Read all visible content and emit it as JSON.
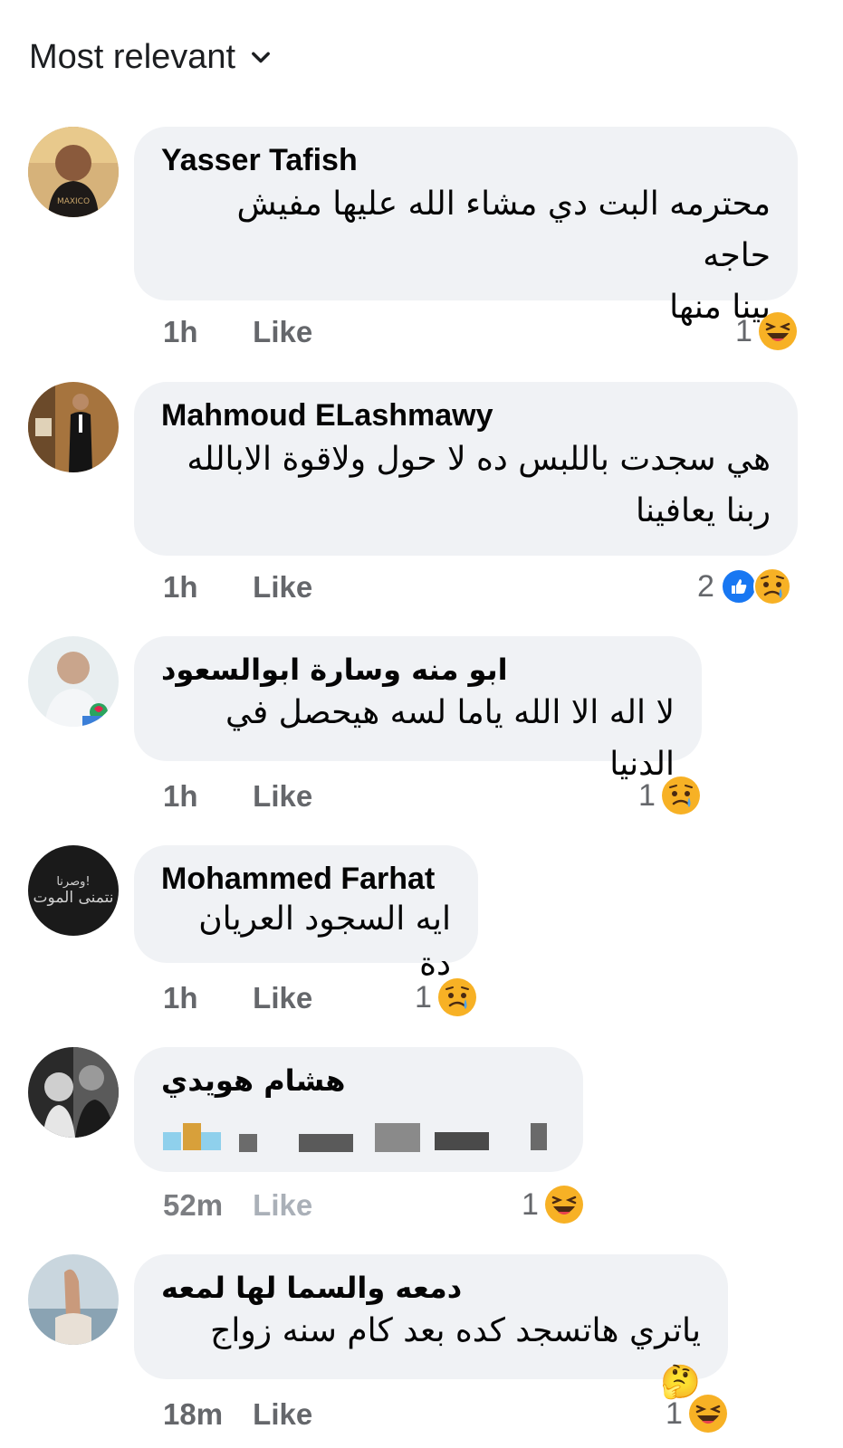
{
  "sort": {
    "label": "Most relevant"
  },
  "comments": [
    {
      "author": "Yasser Tafish",
      "lines": [
        "محترمه البت دي مشاء الله عليها مفيش حاجه",
        "بينا منها"
      ],
      "time": "1h",
      "like": "Like",
      "reaction_count": "1",
      "reactions": [
        "haha"
      ]
    },
    {
      "author": "Mahmoud ELashmawy",
      "lines": [
        "هي سجدت باللبس ده لا حول ولاقوة الابالله",
        "ربنا يعافينا"
      ],
      "time": "1h",
      "like": "Like",
      "reaction_count": "2",
      "reactions": [
        "like",
        "sad"
      ]
    },
    {
      "author": "ابو منه وسارة ابوالسعود",
      "lines": [
        "لا اله الا الله ياما لسه هيحصل في الدنيا"
      ],
      "time": "1h",
      "like": "Like",
      "reaction_count": "1",
      "reactions": [
        "sad"
      ]
    },
    {
      "author": "Mohammed Farhat",
      "lines": [
        "ايه السجود العريان دة"
      ],
      "time": "1h",
      "like": "Like",
      "reaction_count": "1",
      "reactions": [
        "sad"
      ]
    },
    {
      "author": "هشام هويدي",
      "lines": [],
      "time": "52m",
      "like": "Like",
      "reaction_count": "1",
      "reactions": [
        "haha"
      ]
    },
    {
      "author": "دمعه والسما لها لمعه",
      "lines": [
        "ياتري هاتسجد كده بعد كام سنه زواج 🤔"
      ],
      "time": "18m",
      "like": "Like",
      "reaction_count": "1",
      "reactions": [
        "haha"
      ]
    }
  ],
  "avatar_text": {
    "c4_line1": "وصرنا!",
    "c4_line2": "نتمنى الموت"
  },
  "colors": {
    "bubble": "#f0f2f5",
    "meta": "#65676b",
    "like_blue": "#1877f2",
    "emoji_yellow": "#f7b125"
  }
}
